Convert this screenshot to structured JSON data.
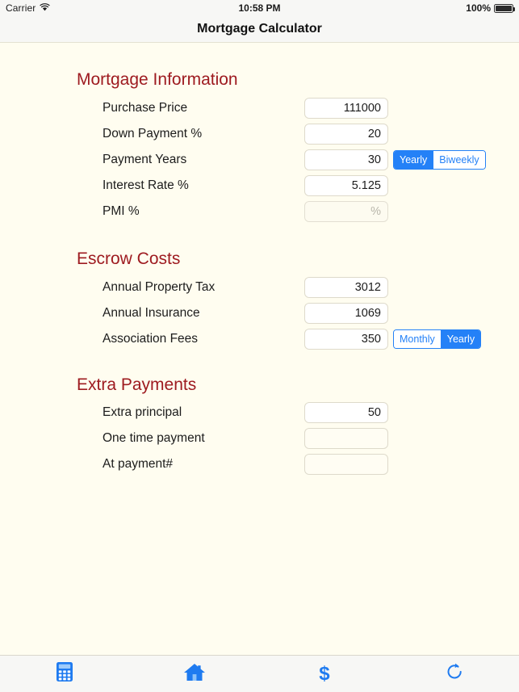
{
  "status_bar": {
    "carrier": "Carrier",
    "wifi_icon": "wifi-icon",
    "time": "10:58 PM",
    "battery_percent": "100%",
    "battery_icon": "battery-full-icon"
  },
  "nav": {
    "title": "Mortgage Calculator"
  },
  "colors": {
    "background": "#fffdf0",
    "section_header": "#9e1b20",
    "accent_blue": "#2481f7",
    "chrome": "#f7f7f5"
  },
  "sections": [
    {
      "title": "Mortgage Information",
      "rows": [
        {
          "label": "Purchase Price",
          "value": "111000",
          "placeholder": "",
          "disabled": false,
          "segmented": null
        },
        {
          "label": "Down Payment %",
          "value": "20",
          "placeholder": "",
          "disabled": false,
          "segmented": null
        },
        {
          "label": "Payment Years",
          "value": "30",
          "placeholder": "",
          "disabled": false,
          "segmented": {
            "options": [
              "Yearly",
              "Biweekly"
            ],
            "selected": "Yearly"
          }
        },
        {
          "label": "Interest Rate %",
          "value": "5.125",
          "placeholder": "",
          "disabled": false,
          "segmented": null
        },
        {
          "label": "PMI %",
          "value": "",
          "placeholder": "%",
          "disabled": true,
          "segmented": null
        }
      ]
    },
    {
      "title": "Escrow Costs",
      "rows": [
        {
          "label": "Annual Property Tax",
          "value": "3012",
          "placeholder": "",
          "disabled": false,
          "segmented": null
        },
        {
          "label": "Annual Insurance",
          "value": "1069",
          "placeholder": "",
          "disabled": false,
          "segmented": null
        },
        {
          "label": "Association Fees",
          "value": "350",
          "placeholder": "",
          "disabled": false,
          "segmented": {
            "options": [
              "Monthly",
              "Yearly"
            ],
            "selected": "Yearly"
          }
        }
      ]
    },
    {
      "title": "Extra Payments",
      "rows": [
        {
          "label": "Extra principal",
          "value": "50",
          "placeholder": "",
          "disabled": false,
          "segmented": null
        },
        {
          "label": "One time payment",
          "value": "",
          "placeholder": "",
          "disabled": false,
          "segmented": null
        },
        {
          "label": "At payment#",
          "value": "",
          "placeholder": "",
          "disabled": false,
          "segmented": null
        }
      ]
    }
  ],
  "tab_bar": {
    "items": [
      {
        "icon": "calculator-icon",
        "name": "tab-calculator"
      },
      {
        "icon": "home-icon",
        "name": "tab-home"
      },
      {
        "icon": "dollar-icon",
        "name": "tab-payments"
      },
      {
        "icon": "refresh-icon",
        "name": "tab-reset"
      }
    ]
  }
}
